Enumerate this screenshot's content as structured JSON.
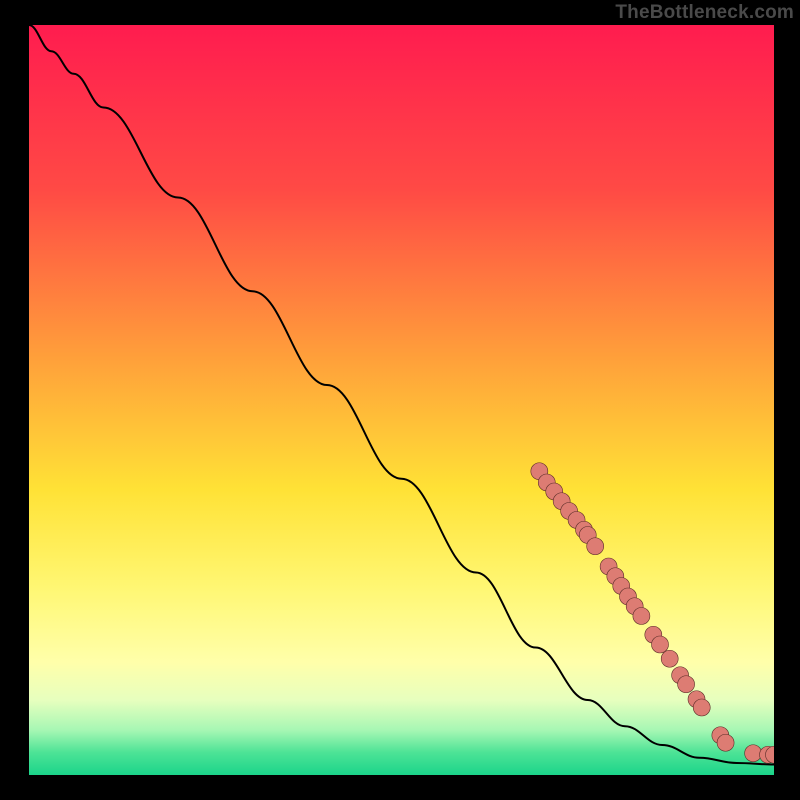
{
  "watermark": "TheBottleneck.com",
  "chart_data": {
    "type": "line",
    "title": "",
    "xlabel": "",
    "ylabel": "",
    "xlim": [
      0,
      100
    ],
    "ylim": [
      0,
      100
    ],
    "gradient_stops": [
      {
        "offset": 0,
        "color": "#ff1c4f"
      },
      {
        "offset": 22,
        "color": "#ff4a45"
      },
      {
        "offset": 45,
        "color": "#ffa23a"
      },
      {
        "offset": 62,
        "color": "#ffe236"
      },
      {
        "offset": 75,
        "color": "#fff773"
      },
      {
        "offset": 85,
        "color": "#ffffaa"
      },
      {
        "offset": 90,
        "color": "#e7ffbe"
      },
      {
        "offset": 94,
        "color": "#a7f7b4"
      },
      {
        "offset": 97,
        "color": "#4de396"
      },
      {
        "offset": 100,
        "color": "#1bd48a"
      }
    ],
    "curve_points": [
      {
        "x": 0.0,
        "y": 100.0
      },
      {
        "x": 3.0,
        "y": 96.5
      },
      {
        "x": 6.0,
        "y": 93.5
      },
      {
        "x": 10.0,
        "y": 89.0
      },
      {
        "x": 20.0,
        "y": 77.0
      },
      {
        "x": 30.0,
        "y": 64.5
      },
      {
        "x": 40.0,
        "y": 52.0
      },
      {
        "x": 50.0,
        "y": 39.5
      },
      {
        "x": 60.0,
        "y": 27.0
      },
      {
        "x": 68.0,
        "y": 17.0
      },
      {
        "x": 75.0,
        "y": 10.0
      },
      {
        "x": 80.0,
        "y": 6.5
      },
      {
        "x": 85.0,
        "y": 4.0
      },
      {
        "x": 90.0,
        "y": 2.3
      },
      {
        "x": 95.0,
        "y": 1.6
      },
      {
        "x": 100.0,
        "y": 1.4
      }
    ],
    "markers": [
      {
        "x": 68.5,
        "y": 40.5
      },
      {
        "x": 69.5,
        "y": 39.0
      },
      {
        "x": 70.5,
        "y": 37.8
      },
      {
        "x": 71.5,
        "y": 36.5
      },
      {
        "x": 72.5,
        "y": 35.2
      },
      {
        "x": 73.5,
        "y": 34.0
      },
      {
        "x": 74.5,
        "y": 32.7
      },
      {
        "x": 75.0,
        "y": 32.0
      },
      {
        "x": 76.0,
        "y": 30.5
      },
      {
        "x": 77.8,
        "y": 27.8
      },
      {
        "x": 78.7,
        "y": 26.5
      },
      {
        "x": 79.5,
        "y": 25.2
      },
      {
        "x": 80.4,
        "y": 23.8
      },
      {
        "x": 81.3,
        "y": 22.5
      },
      {
        "x": 82.2,
        "y": 21.2
      },
      {
        "x": 83.8,
        "y": 18.7
      },
      {
        "x": 84.7,
        "y": 17.4
      },
      {
        "x": 86.0,
        "y": 15.5
      },
      {
        "x": 87.4,
        "y": 13.3
      },
      {
        "x": 88.2,
        "y": 12.1
      },
      {
        "x": 89.6,
        "y": 10.1
      },
      {
        "x": 90.3,
        "y": 9.0
      },
      {
        "x": 92.8,
        "y": 5.3
      },
      {
        "x": 93.5,
        "y": 4.3
      },
      {
        "x": 97.2,
        "y": 2.9
      },
      {
        "x": 99.2,
        "y": 2.7
      },
      {
        "x": 100.0,
        "y": 2.7
      }
    ],
    "marker_style": {
      "radius": 8.5,
      "fill": "#dd7c73",
      "stroke": "#5b2d28",
      "stroke_width": 0.6
    },
    "line_style": {
      "stroke": "#000000",
      "width": 2.0
    }
  }
}
